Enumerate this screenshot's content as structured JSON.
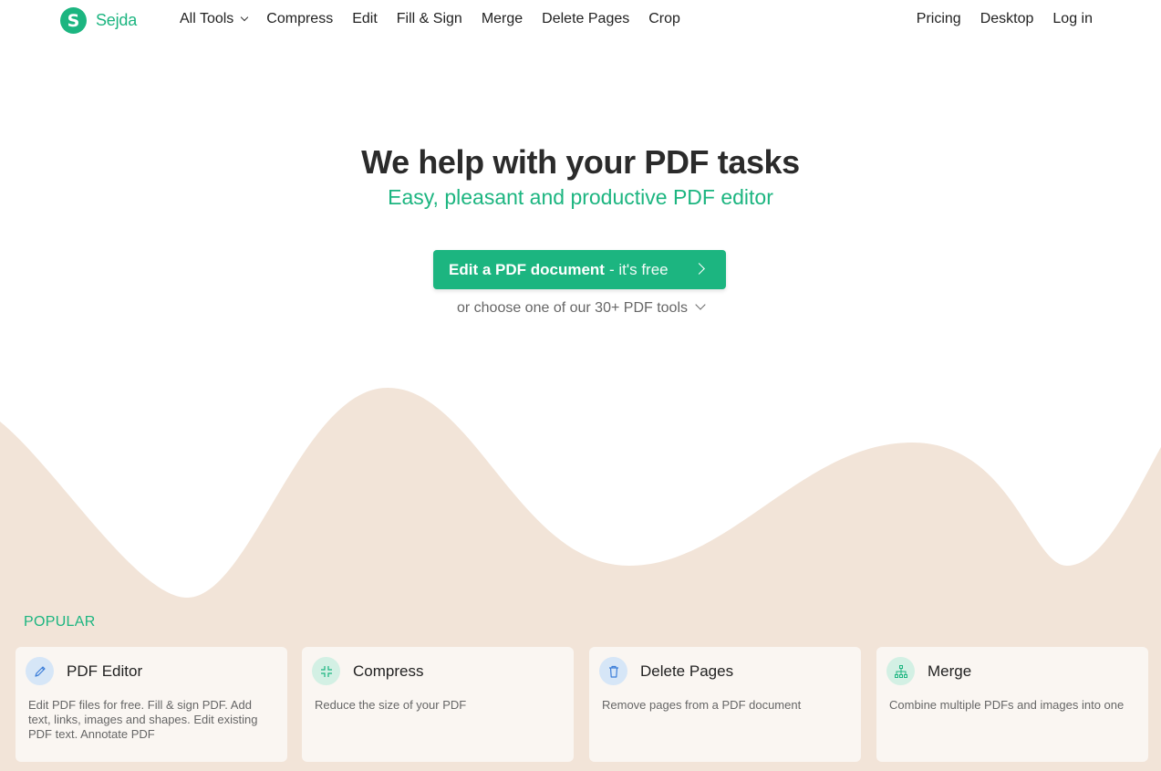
{
  "brand": {
    "logo_letter": "S",
    "name": "Sejda",
    "color": "#1cb580"
  },
  "nav": {
    "all_tools": "All Tools",
    "links": [
      "Compress",
      "Edit",
      "Fill & Sign",
      "Merge",
      "Delete Pages",
      "Crop"
    ],
    "right": {
      "pricing": "Pricing",
      "desktop": "Desktop",
      "login": "Log in"
    }
  },
  "hero": {
    "title": "We help with your PDF tasks",
    "subtitle": "Easy, pleasant and productive PDF editor",
    "cta_main": "Edit a PDF document",
    "cta_free": "- it's free",
    "choose": "or choose one of our 30+ PDF tools"
  },
  "popular": {
    "heading": "POPULAR",
    "cards": [
      {
        "title": "PDF Editor",
        "desc": "Edit PDF files for free. Fill & sign PDF. Add text, links, images and shapes. Edit existing PDF text. Annotate PDF",
        "icon": "pencil-icon",
        "icon_bg": "#d6e6f7",
        "icon_color": "#3b7dd8"
      },
      {
        "title": "Compress",
        "desc": "Reduce the size of your PDF",
        "icon": "compress-icon",
        "icon_bg": "#d3f0e4",
        "icon_color": "#1cb580"
      },
      {
        "title": "Delete Pages",
        "desc": "Remove pages from a PDF document",
        "icon": "trash-icon",
        "icon_bg": "#d6e6f7",
        "icon_color": "#3b7dd8"
      },
      {
        "title": "Merge",
        "desc": "Combine multiple PDFs and images into one",
        "icon": "merge-icon",
        "icon_bg": "#d3f0e4",
        "icon_color": "#1cb580"
      }
    ]
  },
  "colors": {
    "wave": "#f2e4d8",
    "card_bg": "#faf6f2"
  }
}
